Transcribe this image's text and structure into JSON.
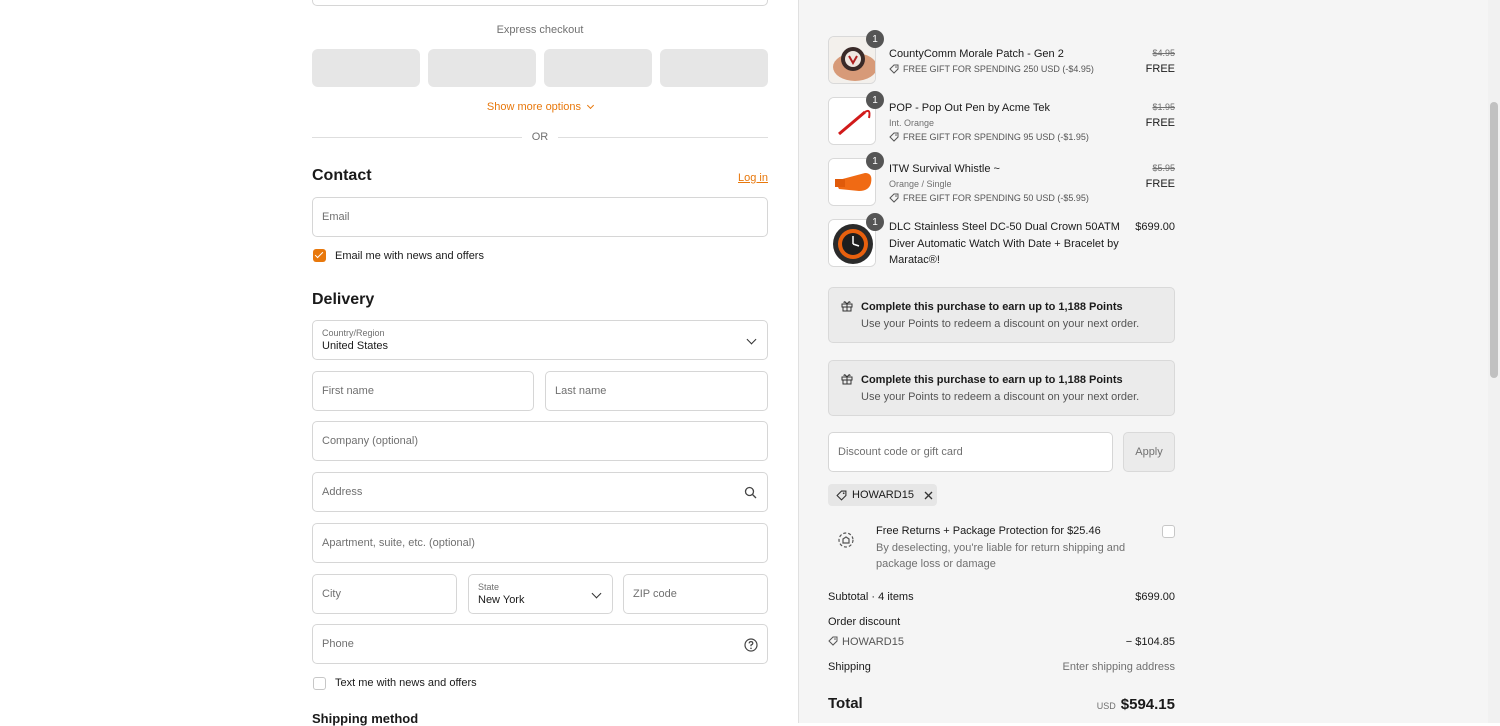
{
  "express": {
    "title": "Express checkout",
    "show_more": "Show more options",
    "or": "OR"
  },
  "contact": {
    "title": "Contact",
    "login": "Log in",
    "email_placeholder": "Email",
    "news_label": "Email me with news and offers",
    "news_checked": true
  },
  "delivery": {
    "title": "Delivery",
    "country_label": "Country/Region",
    "country_value": "United States",
    "first_name": "First name",
    "last_name": "Last name",
    "company": "Company (optional)",
    "address": "Address",
    "apartment": "Apartment, suite, etc. (optional)",
    "city": "City",
    "state_label": "State",
    "state_value": "New York",
    "zip": "ZIP code",
    "phone": "Phone",
    "text_label": "Text me with news and offers",
    "text_checked": false
  },
  "shipping_method": {
    "title": "Shipping method"
  },
  "items": [
    {
      "name": "CountyComm Morale Patch - Gen 2",
      "variant": "",
      "gift": "FREE GIFT FOR SPENDING 250 USD (-$4.95)",
      "original": "$4.95",
      "price": "FREE",
      "qty": "1"
    },
    {
      "name": "POP - Pop Out Pen by Acme Tek",
      "variant": "Int. Orange",
      "gift": "FREE GIFT FOR SPENDING 95 USD (-$1.95)",
      "original": "$1.95",
      "price": "FREE",
      "qty": "1"
    },
    {
      "name": "ITW Survival Whistle ~",
      "variant": "Orange / Single",
      "gift": "FREE GIFT FOR SPENDING 50 USD (-$5.95)",
      "original": "$5.95",
      "price": "FREE",
      "qty": "1"
    },
    {
      "name_lines": [
        "DLC Stainless Steel DC-50 Dual Crown 50ATM",
        "Diver Automatic Watch With Date + Bracelet by",
        "Maratac®!"
      ],
      "price": "$699.00",
      "qty": "1"
    }
  ],
  "points": [
    {
      "title": "Complete this purchase to earn up to 1,188 Points",
      "sub": "Use your Points to redeem a discount on your next order."
    },
    {
      "title": "Complete this purchase to earn up to 1,188 Points",
      "sub": "Use your Points to redeem a discount on your next order."
    }
  ],
  "discount": {
    "placeholder": "Discount code or gift card",
    "apply": "Apply",
    "code": "HOWARD15"
  },
  "protection": {
    "title": "Free Returns + Package Protection for $25.46",
    "desc_lines": [
      "By deselecting, you're liable for return shipping and",
      "package loss or damage"
    ],
    "checked": false
  },
  "summary": {
    "subtotal_label": "Subtotal · 4 items",
    "subtotal": "$699.00",
    "order_discount": "Order discount",
    "discount_code": "HOWARD15",
    "discount_amount": "− $104.85",
    "shipping_label": "Shipping",
    "shipping_value": "Enter shipping address",
    "total_label": "Total",
    "currency": "USD",
    "total": "$594.15"
  },
  "colors": {
    "accent": "#e8780c",
    "panel_bg": "#f5f5f5"
  }
}
